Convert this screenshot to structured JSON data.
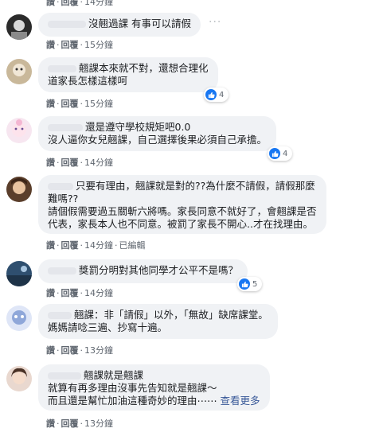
{
  "top_actions": {
    "like": "讚",
    "reply": "回覆",
    "time": "14分鐘"
  },
  "like_label": "讚",
  "reply_label": "回覆",
  "more_menu": "···",
  "comments": [
    {
      "lines": [
        "沒翹過課 有事可以請假"
      ],
      "time": "15分鐘",
      "reaction_count": null
    },
    {
      "lines": [
        "翹課本來就不對，還想合理化",
        "道家長怎樣這樣呵"
      ],
      "time": "15分鐘",
      "reaction_count": "4"
    },
    {
      "lines": [
        "還是遵守學校規矩吧0.0",
        "沒人逼你女兒翹課，自己選擇後果必須自己承擔。"
      ],
      "time": "14分鐘",
      "reaction_count": "4"
    },
    {
      "lines": [
        "只要有理由，翹課就是對的??為什麼不請假，請假那麼",
        "難嗎??",
        "請個假需要過五關斬六將嗎。家長同意不就好了，會翹課是否",
        "代表，家長本人也不同意。被罰了家長不開心..才在找理由。"
      ],
      "time": "14分鐘",
      "edited": "已編輯",
      "reaction_count": null
    },
    {
      "lines": [
        "獎罰分明對其他同學才公平不是嗎？"
      ],
      "time": "14分鐘",
      "reaction_count": "5"
    },
    {
      "lines": [
        "翹課：非「請假」以外，「無故」缺席課堂。",
        "媽媽請唸三遍、抄寫十遍。"
      ],
      "time": "13分鐘",
      "reaction_count": null
    },
    {
      "lines": [
        "翹課就是翹課",
        "就算有再多理由沒事先告知就是翹課～",
        "而且還是幫忙加油這種奇妙的理由⋯⋯"
      ],
      "see_more": "查看更多",
      "time": "13分鐘",
      "reaction_count": null
    }
  ],
  "colors": {
    "bubble": "#f0f2f5",
    "link": "#385898",
    "like_blue": "#1877f2",
    "meta": "#606770"
  }
}
